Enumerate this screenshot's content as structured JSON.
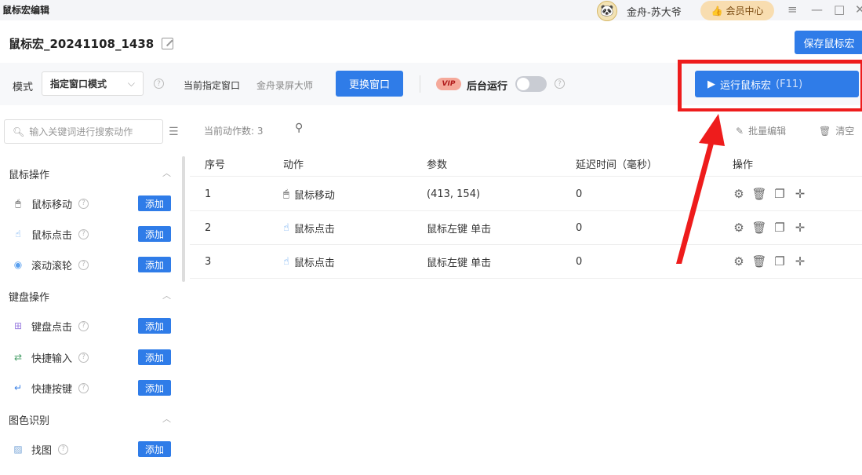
{
  "titlebar": {
    "app_title": "鼠标宏编辑",
    "username": "金舟-苏大爷",
    "vip_center": "会员中心",
    "controls": [
      "≡",
      "—",
      "□",
      "✕"
    ]
  },
  "header": {
    "macro_name": "鼠标宏_20241108_1438",
    "save_label": "保存鼠标宏"
  },
  "toolbar": {
    "mode_label": "模式",
    "mode_value": "指定窗口模式",
    "current_window_label": "当前指定窗口",
    "current_window_value": "金舟录屏大师",
    "change_window_label": "更换窗口",
    "vip_tag": "VIP",
    "background_run_label": "后台运行",
    "run_label": "运行鼠标宏",
    "run_shortcut": "(F11)"
  },
  "sidebar": {
    "search_placeholder": "输入关键词进行搜索动作",
    "add_label": "添加",
    "groups": [
      {
        "title": "鼠标操作",
        "items": [
          "鼠标移动",
          "鼠标点击",
          "滚动滚轮"
        ]
      },
      {
        "title": "键盘操作",
        "items": [
          "键盘点击",
          "快捷输入",
          "快捷按键"
        ]
      },
      {
        "title": "图色识别",
        "items": [
          "找图"
        ]
      }
    ]
  },
  "main": {
    "count_label": "当前动作数: 3",
    "batch_edit": "批量编辑",
    "clear": "清空",
    "columns": [
      "序号",
      "动作",
      "参数",
      "延迟时间（毫秒）",
      "操作"
    ],
    "rows": [
      {
        "index": "1",
        "action": "鼠标移动",
        "param": "(413, 154)",
        "delay": "0"
      },
      {
        "index": "2",
        "action": "鼠标点击",
        "param": "鼠标左键 单击",
        "delay": "0"
      },
      {
        "index": "3",
        "action": "鼠标点击",
        "param": "鼠标左键 单击",
        "delay": "0"
      }
    ]
  },
  "colors": {
    "accent": "#2f7ce8",
    "annotation_red": "#ee1c1c"
  }
}
